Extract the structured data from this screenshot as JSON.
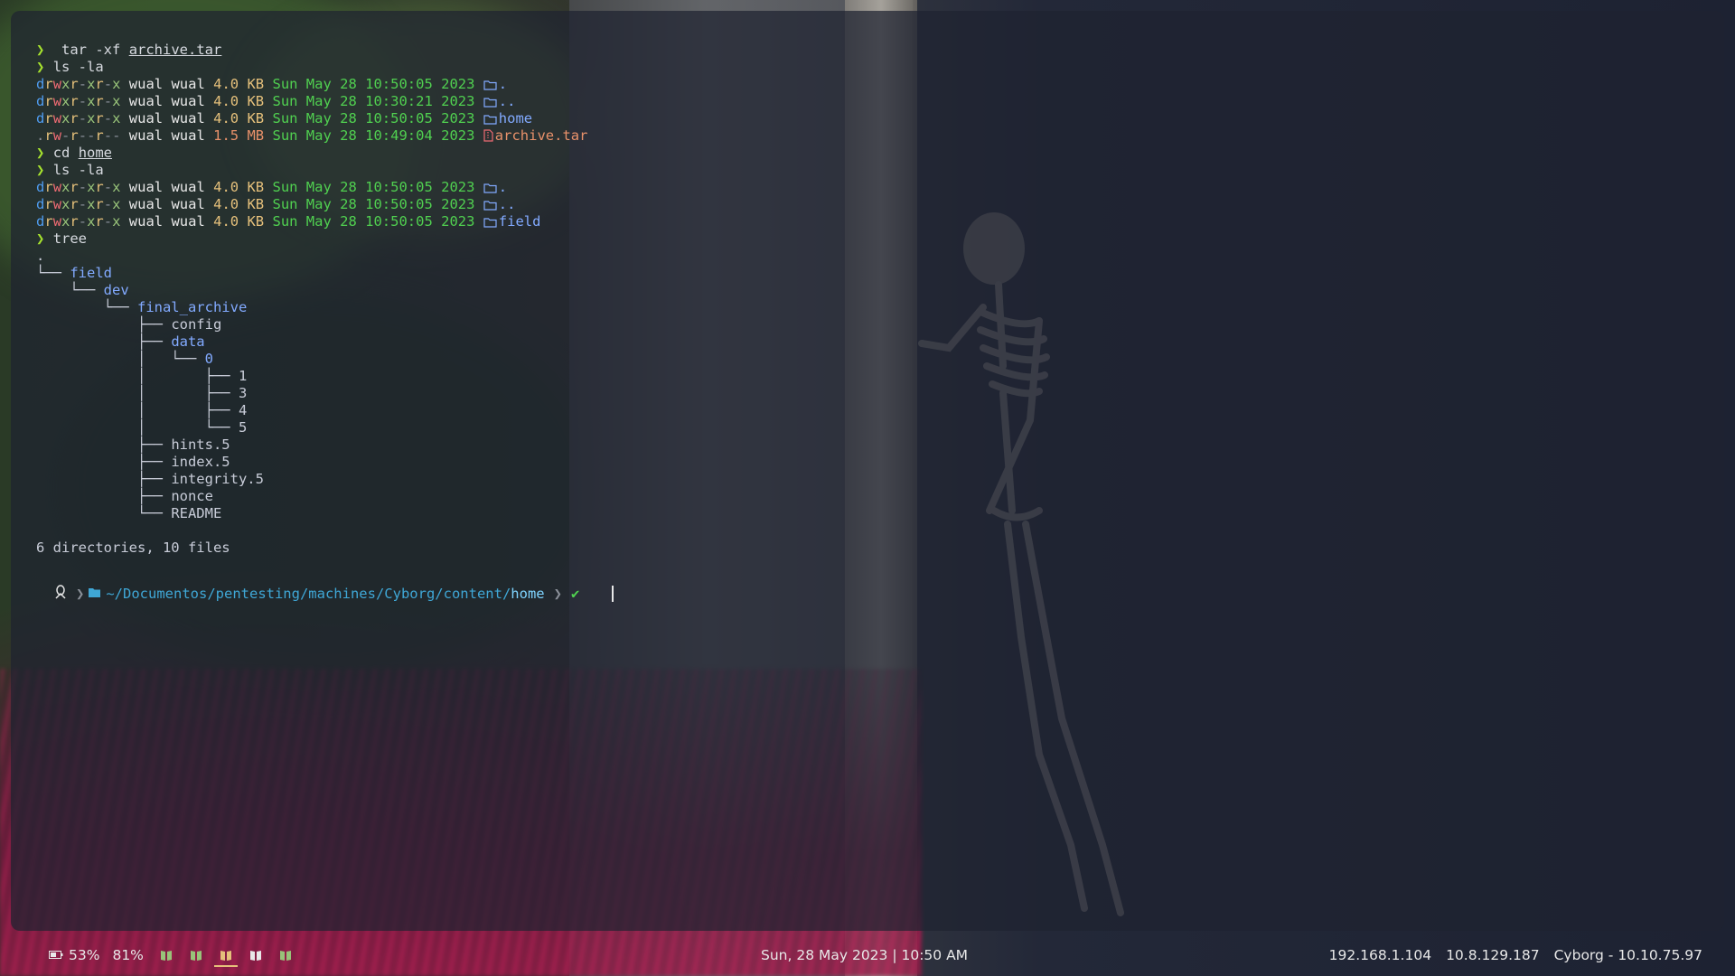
{
  "terminal": {
    "lines": [
      {
        "kind": "cmd",
        "arrow": "❯",
        "text": " tar -xf ",
        "arg": "archive.tar"
      },
      {
        "kind": "cmd",
        "arrow": "❯",
        "text": "ls -la",
        "arg": ""
      },
      {
        "kind": "ls",
        "perm": "drwxr-xr-x",
        "user": "wual",
        "group": "wual",
        "size": "4.0",
        "unit": "KB",
        "date": "Sun May 28 10:50:05 2023",
        "icon": "folder-icon",
        "name": ".",
        "type": "dir"
      },
      {
        "kind": "ls",
        "perm": "drwxr-xr-x",
        "user": "wual",
        "group": "wual",
        "size": "4.0",
        "unit": "KB",
        "date": "Sun May 28 10:30:21 2023",
        "icon": "folder-icon",
        "name": "..",
        "type": "dir"
      },
      {
        "kind": "ls",
        "perm": "drwxr-xr-x",
        "user": "wual",
        "group": "wual",
        "size": "4.0",
        "unit": "KB",
        "date": "Sun May 28 10:50:05 2023",
        "icon": "folder-icon",
        "name": "home",
        "type": "dir"
      },
      {
        "kind": "ls",
        "perm": ".rw-r--r--",
        "user": "wual",
        "group": "wual",
        "size": "1.5",
        "unit": "MB",
        "date": "Sun May 28 10:49:04 2023",
        "icon": "archive-icon",
        "name": "archive.tar",
        "type": "file"
      },
      {
        "kind": "cmd",
        "arrow": "❯",
        "text": "cd ",
        "arg": "home"
      },
      {
        "kind": "cmd",
        "arrow": "❯",
        "text": "ls -la",
        "arg": ""
      },
      {
        "kind": "ls",
        "perm": "drwxr-xr-x",
        "user": "wual",
        "group": "wual",
        "size": "4.0",
        "unit": "KB",
        "date": "Sun May 28 10:50:05 2023",
        "icon": "folder-icon",
        "name": ".",
        "type": "dir"
      },
      {
        "kind": "ls",
        "perm": "drwxr-xr-x",
        "user": "wual",
        "group": "wual",
        "size": "4.0",
        "unit": "KB",
        "date": "Sun May 28 10:50:05 2023",
        "icon": "folder-icon",
        "name": "..",
        "type": "dir"
      },
      {
        "kind": "ls",
        "perm": "drwxr-xr-x",
        "user": "wual",
        "group": "wual",
        "size": "4.0",
        "unit": "KB",
        "date": "Sun May 28 10:50:05 2023",
        "icon": "folder-icon",
        "name": "field",
        "type": "dir"
      },
      {
        "kind": "cmd",
        "arrow": "❯",
        "text": "tree",
        "arg": ""
      },
      {
        "kind": "tree",
        "prefix": ".",
        "name": "",
        "type": "file"
      },
      {
        "kind": "tree",
        "prefix": "└── ",
        "name": "field",
        "type": "dir"
      },
      {
        "kind": "tree",
        "prefix": "    └── ",
        "name": "dev",
        "type": "dir"
      },
      {
        "kind": "tree",
        "prefix": "        └── ",
        "name": "final_archive",
        "type": "dir"
      },
      {
        "kind": "tree",
        "prefix": "            ├── ",
        "name": "config",
        "type": "file"
      },
      {
        "kind": "tree",
        "prefix": "            ├── ",
        "name": "data",
        "type": "dir"
      },
      {
        "kind": "tree",
        "prefix": "            │   └── ",
        "name": "0",
        "type": "dir"
      },
      {
        "kind": "tree",
        "prefix": "            │       ├── ",
        "name": "1",
        "type": "file"
      },
      {
        "kind": "tree",
        "prefix": "            │       ├── ",
        "name": "3",
        "type": "file"
      },
      {
        "kind": "tree",
        "prefix": "            │       ├── ",
        "name": "4",
        "type": "file"
      },
      {
        "kind": "tree",
        "prefix": "            │       └── ",
        "name": "5",
        "type": "file"
      },
      {
        "kind": "tree",
        "prefix": "            ├── ",
        "name": "hints.5",
        "type": "file"
      },
      {
        "kind": "tree",
        "prefix": "            ├── ",
        "name": "index.5",
        "type": "file"
      },
      {
        "kind": "tree",
        "prefix": "            ├── ",
        "name": "integrity.5",
        "type": "file"
      },
      {
        "kind": "tree",
        "prefix": "            ├── ",
        "name": "nonce",
        "type": "file"
      },
      {
        "kind": "tree",
        "prefix": "            └── ",
        "name": "README",
        "type": "file"
      },
      {
        "kind": "blank"
      },
      {
        "kind": "summary",
        "text": "6 directories, 10 files"
      }
    ],
    "prompt": {
      "os_icon": "linux-tux-icon",
      "folder_icon": "folder-open-icon",
      "path_prefix": "~/Documentos/pentesting/machines/Cyborg/content/",
      "path_current": "home",
      "status": "✔"
    }
  },
  "statusbar": {
    "battery_icon": "battery-icon",
    "battery": "53%",
    "volume": "81%",
    "workspaces": [
      {
        "icon": "book-icon",
        "color": "#98c379",
        "active": false
      },
      {
        "icon": "book-icon",
        "color": "#98c379",
        "active": false
      },
      {
        "icon": "book-icon",
        "color": "#e5c07b",
        "active": true
      },
      {
        "icon": "book-icon",
        "color": "#e8e8e8",
        "active": false
      },
      {
        "icon": "book-icon",
        "color": "#98c379",
        "active": false
      }
    ],
    "datetime": "Sun, 28 May 2023 | 10:50 AM",
    "ip_local": "192.168.1.104",
    "ip_vpn": "10.8.129.187",
    "target": "Cyborg - 10.10.75.97"
  },
  "colors": {
    "accent_green": "#a6e22e",
    "date_green": "#50d050",
    "dir_blue": "#82aaff",
    "path_blue": "#3fa7d6"
  }
}
